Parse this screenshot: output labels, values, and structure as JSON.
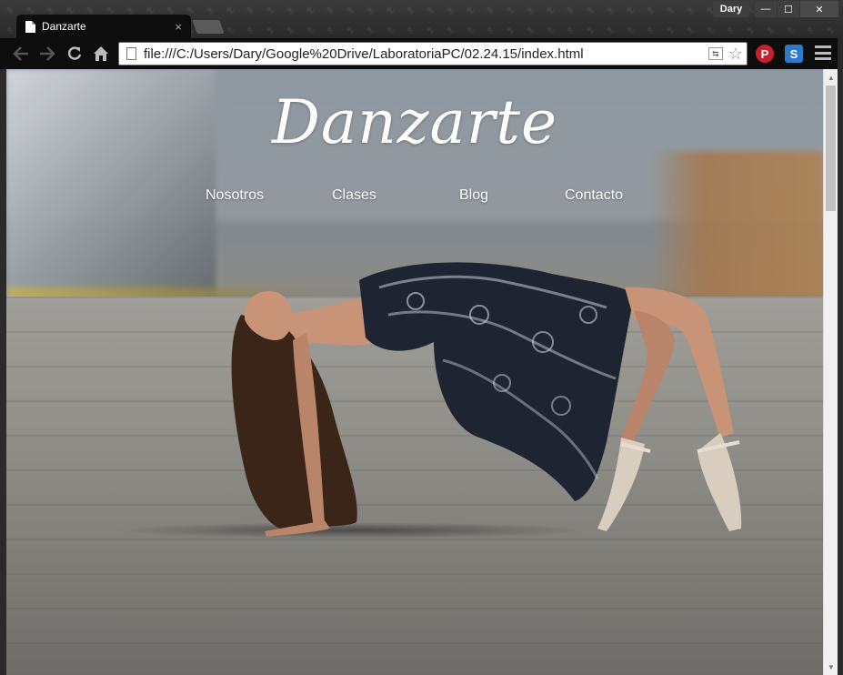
{
  "browser": {
    "tab_title": "Danzarte",
    "tab_close": "×",
    "user_name": "Dary",
    "window_min": "—",
    "window_max": "☐",
    "window_close": "✕",
    "url": "file:///C:/Users/Dary/Google%20Drive/LaboratoriaPC/02.24.15/index.html",
    "ext_pinterest": "P",
    "ext_s": "S"
  },
  "site": {
    "brand": "Danzarte",
    "nav": [
      {
        "label": "Nosotros"
      },
      {
        "label": "Clases"
      },
      {
        "label": "Blog"
      },
      {
        "label": "Contacto"
      }
    ]
  },
  "colors": {
    "nav_text": "#ffffff",
    "pinterest": "#c8202a",
    "extension_s": "#2d78c8"
  },
  "icons": {
    "back": "arrow-left-icon",
    "forward": "arrow-right-icon",
    "reload": "reload-icon",
    "home": "home-icon",
    "star": "star-icon",
    "menu": "hamburger-menu-icon"
  }
}
